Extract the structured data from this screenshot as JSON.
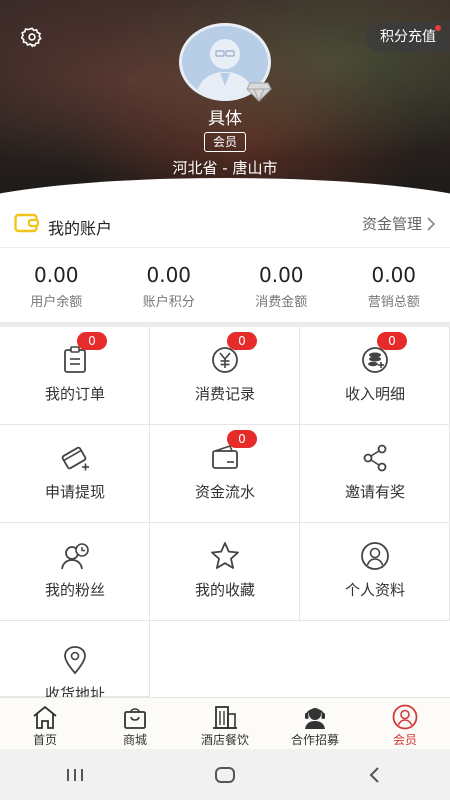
{
  "header": {
    "recharge_label": "积分充值",
    "username": "具体",
    "member_tag": "会员",
    "location": "河北省 - 唐山市"
  },
  "account": {
    "title": "我的账户",
    "manage_label": "资金管理"
  },
  "stats": [
    {
      "value": "0.00",
      "label": "用户余额"
    },
    {
      "value": "0.00",
      "label": "账户积分"
    },
    {
      "value": "0.00",
      "label": "消费金额"
    },
    {
      "value": "0.00",
      "label": "营销总额"
    }
  ],
  "grid": [
    {
      "label": "我的订单",
      "icon": "order-icon",
      "badge": "0"
    },
    {
      "label": "消费记录",
      "icon": "yen-icon",
      "badge": "0"
    },
    {
      "label": "收入明细",
      "icon": "income-icon",
      "badge": "0"
    },
    {
      "label": "申请提现",
      "icon": "card-icon"
    },
    {
      "label": "资金流水",
      "icon": "wallet-icon",
      "badge": "0"
    },
    {
      "label": "邀请有奖",
      "icon": "share-icon"
    },
    {
      "label": "我的粉丝",
      "icon": "fans-icon"
    },
    {
      "label": "我的收藏",
      "icon": "star-icon"
    },
    {
      "label": "个人资料",
      "icon": "profile-icon"
    },
    {
      "label": "收货地址",
      "icon": "location-pin-icon"
    }
  ],
  "tabbar": [
    {
      "label": "首页",
      "icon": "home-icon"
    },
    {
      "label": "商城",
      "icon": "shopping-bag-icon"
    },
    {
      "label": "酒店餐饮",
      "icon": "building-icon"
    },
    {
      "label": "合作招募",
      "icon": "headset-icon"
    },
    {
      "label": "会员",
      "icon": "member-icon",
      "active": true
    }
  ],
  "colors": {
    "accent": "#d23a3a",
    "badge": "#e62b2b",
    "wallet_icon": "#f0c419"
  }
}
